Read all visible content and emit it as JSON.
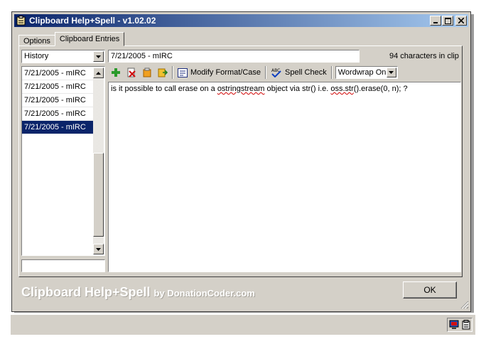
{
  "window": {
    "title": "Clipboard Help+Spell - v1.02.02"
  },
  "tabs": [
    {
      "label": "Options"
    },
    {
      "label": "Clipboard Entries"
    }
  ],
  "sidebar": {
    "combo_value": "History",
    "items": [
      {
        "label": "7/21/2005 - mIRC",
        "selected": false
      },
      {
        "label": "7/21/2005 - mIRC",
        "selected": false
      },
      {
        "label": "7/21/2005 - mIRC",
        "selected": false
      },
      {
        "label": "7/21/2005 - mIRC",
        "selected": false
      },
      {
        "label": "7/21/2005 - mIRC",
        "selected": true
      }
    ]
  },
  "entry": {
    "title": "7/21/2005 - mIRC",
    "char_count": "94 characters in clip",
    "text_parts": [
      {
        "t": "is it possible to call erase on a "
      },
      {
        "t": "ostringstream",
        "squiggle": true
      },
      {
        "t": " object via str() i.e. "
      },
      {
        "t": "oss.str",
        "squiggle": true
      },
      {
        "t": "().erase(0, n); ?"
      }
    ]
  },
  "toolbar": {
    "modify_label": "Modify Format/Case",
    "spell_label": "Spell Check",
    "wordwrap_value": "Wordwrap On"
  },
  "footer": {
    "brand": "Clipboard Help+Spell",
    "by": "by DonationCoder.com",
    "ok_label": "OK"
  },
  "colors": {
    "titlebar_start": "#0a246a",
    "titlebar_end": "#a6caf0",
    "selection": "#0a246a",
    "face": "#d4d0c8"
  }
}
